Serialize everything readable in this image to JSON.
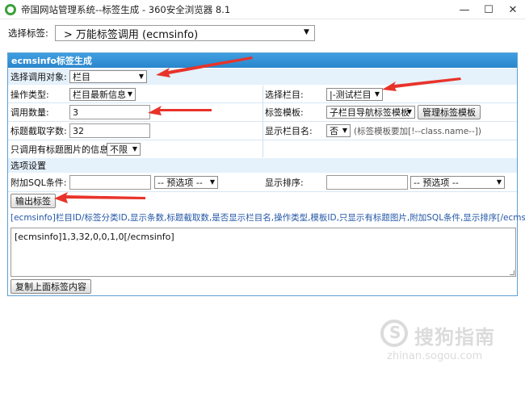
{
  "window": {
    "title": "帝国网站管理系统--标签生成 - 360安全浏览器 8.1",
    "minimize": "—",
    "maximize": "☐",
    "close": "✕"
  },
  "tag_select": {
    "label": "选择标签:",
    "value": "> 万能标签调用 (ecmsinfo)"
  },
  "panel": {
    "header": "ecmsinfo标签生成",
    "call_object_label": "选择调用对象:",
    "call_object_value": "栏目",
    "operation_label": "操作类型:",
    "operation_value": "栏目最新信息",
    "column_label": "选择栏目:",
    "column_value": "|-测试栏目",
    "count_label": "调用数量:",
    "count_value": "3",
    "template_label": "标签模板:",
    "template_value": "子栏目导航标签模板",
    "manage_template_button": "管理标签模板",
    "title_len_label": "标题截取字数:",
    "title_len_value": "32",
    "show_colname_label": "显示栏目名:",
    "show_colname_value": "否",
    "show_colname_hint": "(标签模板要加[!--class.name--])",
    "only_pic_label": "只调用有标题图片的信息:",
    "only_pic_value": "不限",
    "options_section": "选项设置",
    "sql_label": "附加SQL条件:",
    "sql_value": "",
    "sql_preset": "-- 预选项 --",
    "order_label": "显示排序:",
    "order_value": "",
    "order_preset": "-- 预选项 --",
    "output_button": "输出标签",
    "syntax": "[ecmsinfo]栏目ID/标签分类ID,显示条数,标题截取数,是否显示栏目名,操作类型,模板ID,只显示有标题图片,附加SQL条件,显示排序[/ecmsinfo]",
    "generated": "[ecmsinfo]1,3,32,0,0,1,0[/ecmsinfo]",
    "copy_button": "复制上面标签内容"
  },
  "watermark": {
    "text": "搜狗指南",
    "sub": "zhinan.sogou.com"
  },
  "colors": {
    "header_blue": "#2a86cc",
    "row_blue": "#e5f1fb",
    "annotation_red": "#e8332a",
    "syntax_blue": "#2457a7"
  }
}
